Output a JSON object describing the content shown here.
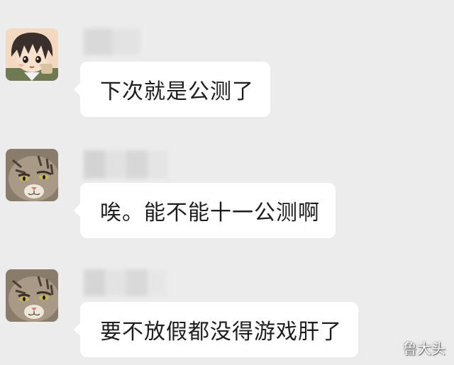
{
  "messages": [
    {
      "sender_avatar": "anime-boy-avatar",
      "text": "下次就是公测了"
    },
    {
      "sender_avatar": "cat-avatar",
      "text": "唉。能不能十一公测啊"
    },
    {
      "sender_avatar": "cat-avatar",
      "text": "要不放假都没得游戏肝了"
    }
  ],
  "watermark": {
    "text": "鲁大头"
  },
  "colors": {
    "background": "#ececec",
    "bubble": "#ffffff",
    "text": "#1d1d1d"
  }
}
